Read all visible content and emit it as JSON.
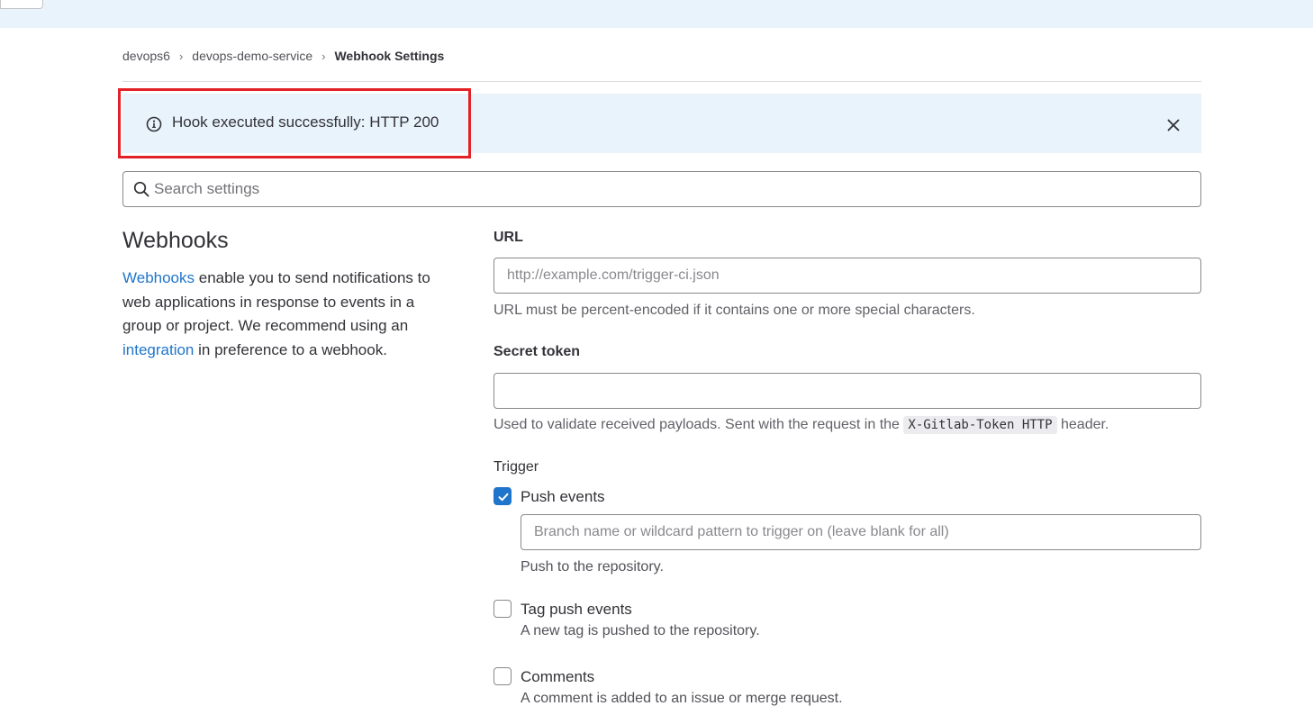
{
  "breadcrumb": {
    "items": [
      "devops6",
      "devops-demo-service"
    ],
    "current": "Webhook Settings"
  },
  "alert": {
    "message": "Hook executed successfully: HTTP 200",
    "icon": "info-icon",
    "close_icon": "close-icon"
  },
  "search": {
    "placeholder": "Search settings"
  },
  "webhooks": {
    "title": "Webhooks",
    "desc_link1": "Webhooks",
    "desc_part1": " enable you to send notifications to web applications in response to events in a group or project. We recommend using an ",
    "desc_link2": "integration",
    "desc_part2": " in preference to a webhook."
  },
  "form": {
    "url_label": "URL",
    "url_placeholder": "http://example.com/trigger-ci.json",
    "url_value": "",
    "url_help": "URL must be percent-encoded if it contains one or more special characters.",
    "token_label": "Secret token",
    "token_value": "",
    "token_help_prefix": "Used to validate received payloads. Sent with the request in the ",
    "token_help_code": "X-Gitlab-Token HTTP",
    "token_help_suffix": " header.",
    "trigger_label": "Trigger",
    "push": {
      "label": "Push events",
      "checked": true,
      "branch_placeholder": "Branch name or wildcard pattern to trigger on (leave blank for all)",
      "help": "Push to the repository."
    },
    "tag_push": {
      "label": "Tag push events",
      "checked": false,
      "help": "A new tag is pushed to the repository."
    },
    "comments": {
      "label": "Comments",
      "checked": false,
      "help": "A comment is added to an issue or merge request."
    }
  },
  "colors": {
    "alert_bg": "#e9f3fc",
    "link": "#1f75cb",
    "highlight": "#e32228",
    "checkbox_checked": "#1f75cb"
  }
}
